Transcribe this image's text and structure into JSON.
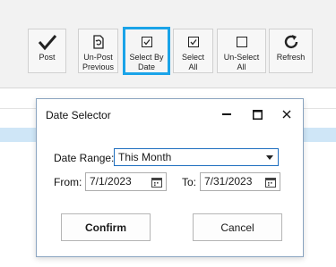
{
  "toolbar": {
    "buttons": [
      {
        "label": "Post",
        "icon": "checkmark-icon"
      },
      {
        "label": "Un-Post\nPrevious",
        "icon": "document-undo-icon"
      },
      {
        "label": "Select By\nDate",
        "icon": "checkbox-checked-icon"
      },
      {
        "label": "Select\nAll",
        "icon": "checkbox-checked-icon"
      },
      {
        "label": "Un-Select\nAll",
        "icon": "checkbox-empty-icon"
      },
      {
        "label": "Refresh",
        "icon": "refresh-icon"
      }
    ]
  },
  "dialog": {
    "title": "Date Selector",
    "date_range_label": "Date Range:",
    "date_range_value": "This Month",
    "from_label": "From:",
    "from_value": "7/1/2023",
    "to_label": "To:",
    "to_value": "7/31/2023",
    "confirm_label": "Confirm",
    "cancel_label": "Cancel"
  },
  "colors": {
    "highlight": "#1aa3e8",
    "selected_row": "#cfe6f7",
    "combo_border": "#1f6fbf"
  }
}
